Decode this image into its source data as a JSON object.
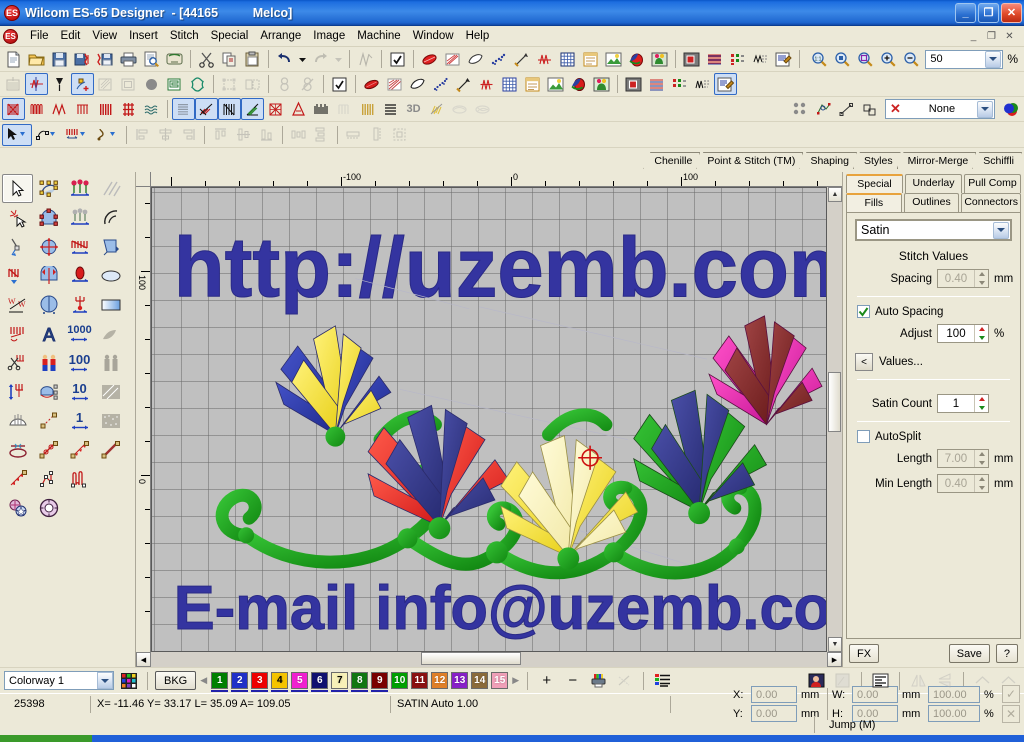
{
  "window": {
    "app_icon": "ES",
    "title": "Wilcom ES-65 Designer  - [44165          Melco]",
    "minimize": "_",
    "maximize": "❐",
    "close": "✕"
  },
  "menubar": {
    "logo": "ES",
    "items": [
      "File",
      "Edit",
      "View",
      "Insert",
      "Stitch",
      "Special",
      "Arrange",
      "Image",
      "Machine",
      "Window",
      "Help"
    ],
    "mdi_buttons": [
      "_",
      "❐",
      "✕"
    ]
  },
  "toolbars": {
    "standard": [
      {
        "name": "new-document",
        "icon": "page"
      },
      {
        "name": "open-document",
        "icon": "folder"
      },
      {
        "name": "save-document",
        "icon": "floppy"
      },
      {
        "name": "save-stitch-file",
        "icon": "floppy-stitch"
      },
      {
        "name": "save-as-machine-file",
        "icon": "floppy-machine"
      },
      {
        "name": "print",
        "icon": "printer"
      },
      {
        "name": "print-preview",
        "icon": "preview"
      },
      {
        "name": "send-to-machine",
        "icon": "machine"
      },
      {
        "name": "cut",
        "icon": "scissors"
      },
      {
        "name": "copy",
        "icon": "copy"
      },
      {
        "name": "paste",
        "icon": "clipboard"
      },
      {
        "name": "undo",
        "icon": "undo"
      },
      {
        "name": "undo-dropdown",
        "icon": "caret"
      },
      {
        "name": "redo",
        "icon": "redo"
      },
      {
        "name": "redo-dropdown",
        "icon": "caret"
      },
      {
        "name": "stitch-edit",
        "icon": "stitch-edit"
      },
      {
        "name": "properties",
        "icon": "props"
      },
      {
        "name": "object-properties",
        "icon": "checkbox"
      },
      {
        "name": "satin-fill",
        "icon": "satin"
      },
      {
        "name": "tatami-fill",
        "icon": "tatami"
      },
      {
        "name": "outline-fill",
        "icon": "outline"
      },
      {
        "name": "motif-fill",
        "icon": "motif"
      },
      {
        "name": "stitch-angle",
        "icon": "angle"
      },
      {
        "name": "stitch-direction",
        "icon": "direction"
      },
      {
        "name": "grid-toggle",
        "icon": "grid"
      },
      {
        "name": "hoop-toggle",
        "icon": "hoop"
      },
      {
        "name": "backdrop",
        "icon": "backdrop"
      },
      {
        "name": "color-fill",
        "icon": "colorfill"
      },
      {
        "name": "artwork",
        "icon": "artwork"
      },
      {
        "name": "bitmap-view",
        "icon": "bitmap"
      },
      {
        "name": "stitch-view",
        "icon": "stitchview"
      },
      {
        "name": "needle-points",
        "icon": "needlepoints"
      },
      {
        "name": "connectors-view",
        "icon": "connectors"
      },
      {
        "name": "design-info",
        "icon": "designinfo"
      }
    ],
    "arrange": [
      {
        "name": "align-left",
        "icon": "align-left",
        "disabled": true
      },
      {
        "name": "align-center-h",
        "icon": "align-center-h",
        "disabled": true
      },
      {
        "name": "align-right",
        "icon": "align-right",
        "disabled": true
      },
      {
        "name": "align-top",
        "icon": "align-top",
        "disabled": true
      },
      {
        "name": "align-middle",
        "icon": "align-middle",
        "disabled": true
      },
      {
        "name": "align-bottom",
        "icon": "align-bottom",
        "disabled": true
      },
      {
        "name": "distribute-h",
        "icon": "dist-h",
        "disabled": true
      },
      {
        "name": "distribute-v",
        "icon": "dist-v",
        "disabled": true
      },
      {
        "name": "same-width",
        "icon": "same-w",
        "disabled": true
      },
      {
        "name": "same-height",
        "icon": "same-h",
        "disabled": true
      },
      {
        "name": "same-size",
        "icon": "same-size",
        "disabled": true
      }
    ],
    "zoom": {
      "buttons": [
        {
          "name": "zoom-1-1",
          "icon": "zoom11"
        },
        {
          "name": "zoom-to-selection",
          "icon": "zoomsel"
        },
        {
          "name": "zoom-to-hoop",
          "icon": "zoomhoop"
        },
        {
          "name": "zoom-in",
          "icon": "zoomin"
        },
        {
          "name": "zoom-out",
          "icon": "zoomout"
        }
      ],
      "value": "50",
      "unit": "%"
    },
    "stitch_types": [
      {
        "name": "satin-stitch",
        "icon": "satin-red",
        "selected": true
      },
      {
        "name": "zigzag-stitch",
        "icon": "zigzag-red"
      },
      {
        "name": "e-stitch",
        "icon": "e-stitch"
      },
      {
        "name": "blanket-stitch",
        "icon": "blanket"
      },
      {
        "name": "tatami-stitch",
        "icon": "tatami-red"
      },
      {
        "name": "program-split",
        "icon": "prog-split"
      },
      {
        "name": "ripple-stitch",
        "icon": "ripple"
      },
      {
        "name": "fill-stitch",
        "icon": "fill-dots"
      },
      {
        "name": "contour-stitch",
        "icon": "contour"
      },
      {
        "name": "satin-column",
        "icon": "satin-col"
      },
      {
        "name": "gradient-fill",
        "icon": "gradient"
      },
      {
        "name": "cross-stitch",
        "icon": "cross"
      },
      {
        "name": "auto-applique",
        "icon": "applique"
      },
      {
        "name": "motif-run",
        "icon": "motif-run"
      },
      {
        "name": "candlewick",
        "icon": "candlewick",
        "disabled": true
      },
      {
        "name": "pattern-fill",
        "icon": "pattern-fill"
      },
      {
        "name": "stitch-layers",
        "icon": "layers"
      },
      {
        "name": "3d-view",
        "icon": "3d-text",
        "label": "3D"
      },
      {
        "name": "lettering-fill",
        "icon": "lettering-fill"
      },
      {
        "name": "trapunto",
        "icon": "trapunto",
        "disabled": true
      },
      {
        "name": "trapunto-outline",
        "icon": "trapunto2",
        "disabled": true
      }
    ],
    "modes": [
      {
        "name": "select-object-mode",
        "icon": "arrow-drop"
      },
      {
        "name": "reshape-mode",
        "icon": "reshape-drop"
      },
      {
        "name": "stitch-mode",
        "icon": "nn-drop"
      },
      {
        "name": "digitize-mode",
        "icon": "pen-drop"
      }
    ],
    "connectors": {
      "buttons": [
        {
          "name": "auto-start-stop",
          "icon": "autostartstop"
        },
        {
          "name": "connection-points",
          "icon": "connpoints"
        },
        {
          "name": "entry-point",
          "icon": "entry"
        },
        {
          "name": "exit-point",
          "icon": "exit"
        }
      ],
      "trim_icon": "red-x",
      "selected_value": "None",
      "color_wheel": "color-wheel"
    }
  },
  "doc_tabs": [
    "Chenille",
    "Point & Stitch (TM)",
    "Shaping",
    "Styles",
    "Mirror-Merge",
    "Schiffli"
  ],
  "left_toolbox": [
    {
      "name": "select-tool",
      "icon": "arrow",
      "selected": true
    },
    {
      "name": "reshape-tool",
      "icon": "reshape-node"
    },
    {
      "name": "lettering-tool",
      "icon": "flowers"
    },
    {
      "name": "slow-redraw-tool",
      "icon": "diag-lines"
    },
    {
      "name": "magic-wand-tool",
      "icon": "magic-wand"
    },
    {
      "name": "arch-reshape-tool",
      "icon": "arch-node"
    },
    {
      "name": "motif-lettering-tool",
      "icon": "flower-gray"
    },
    {
      "name": "arc-tool",
      "icon": "arc"
    },
    {
      "name": "knife-tool",
      "icon": "knife"
    },
    {
      "name": "mirror-merge-tool",
      "icon": "mirror-circle"
    },
    {
      "name": "zigzag-tool",
      "icon": "zigzag-red2"
    },
    {
      "name": "break-apart-tool",
      "icon": "break-apart"
    },
    {
      "name": "stitch-editor-tool",
      "icon": "stitch-arrow"
    },
    {
      "name": "mirror-horizontal-tool",
      "icon": "mirror-x"
    },
    {
      "name": "satin-blob-tool",
      "icon": "red-blob"
    },
    {
      "name": "ellipse-tool",
      "icon": "ellipse"
    },
    {
      "name": "stitch-swap-tool",
      "icon": "w-swap"
    },
    {
      "name": "wreath-tool",
      "icon": "wreath"
    },
    {
      "name": "anchor-stitch-tool",
      "icon": "anchor"
    },
    {
      "name": "rectangle-tool",
      "icon": "rect-grad"
    },
    {
      "name": "remove-stitches-tool",
      "icon": "stitch-cut"
    },
    {
      "name": "letter-a-tool",
      "icon": "letter-a"
    },
    {
      "name": "stitch-count-1000",
      "icon": "num",
      "label": "1000"
    },
    {
      "name": "fabric-tool",
      "icon": "fabric-gray"
    },
    {
      "name": "trim-tool",
      "icon": "scissors-stitch"
    },
    {
      "name": "twins-tool",
      "icon": "twins"
    },
    {
      "name": "stitch-count-100",
      "icon": "num",
      "label": "100"
    },
    {
      "name": "figures-tool",
      "icon": "figures-gray"
    },
    {
      "name": "insert-stitch-tool",
      "icon": "insert-stitch"
    },
    {
      "name": "envelope-tool",
      "icon": "envelope-node"
    },
    {
      "name": "stitch-count-10",
      "icon": "num",
      "label": "10"
    },
    {
      "name": "texture-tool",
      "icon": "texture-gray"
    },
    {
      "name": "fan-tool",
      "icon": "fan"
    },
    {
      "name": "open-line-tool",
      "icon": "open-line"
    },
    {
      "name": "stitch-count-1",
      "icon": "num",
      "label": "1"
    },
    {
      "name": "noise-tool",
      "icon": "noise-gray"
    },
    {
      "name": "elastic-tool",
      "icon": "elastic"
    },
    {
      "name": "curve-line-tool",
      "icon": "curve-line"
    },
    {
      "name": "motif-line-tool",
      "icon": "motif-line"
    },
    {
      "name": "straight-line-tool",
      "icon": "straight-line"
    },
    {
      "name": "run-line-tool",
      "icon": "run-line"
    },
    {
      "name": "polyline-tool",
      "icon": "polyline"
    },
    {
      "name": "zigzag-line-tool",
      "icon": "zigzag-line"
    },
    {
      "name": "star-stamp-tool",
      "icon": "star-stamp"
    },
    {
      "name": "wheel-tool",
      "icon": "wheel"
    }
  ],
  "rulers": {
    "horizontal_labels": [
      "-100",
      "0",
      "100"
    ],
    "vertical_labels": [
      "100",
      "0"
    ]
  },
  "canvas": {
    "design_text_top": "http://uzemb.com",
    "design_text_bottom": "E-mail  info@uzemb.com",
    "text_color": "#3434a0",
    "background": "#c0c0c0",
    "flower_colors": [
      "#f2e23c",
      "#2c3aa8",
      "#e63030",
      "#3a3f8c",
      "#f5f0a8",
      "#2b9b2b",
      "#3b3fa0",
      "#e03ab0",
      "#8b2b2b"
    ],
    "vine_color": "#2eb82e"
  },
  "right_panel": {
    "tabs_top": [
      "Special",
      "Underlay",
      "Pull Comp"
    ],
    "tabs_bottom": [
      "Fills",
      "Outlines",
      "Connectors"
    ],
    "active_tab": "Fills",
    "fill_type": "Satin",
    "stitch_values_header": "Stitch Values",
    "spacing_label": "Spacing",
    "spacing_value": "0.40",
    "spacing_unit": "mm",
    "auto_spacing_label": "Auto Spacing",
    "auto_spacing_checked": true,
    "adjust_label": "Adjust",
    "adjust_value": "100",
    "adjust_unit": "%",
    "values_button": "Values...",
    "values_arrow": "<",
    "satin_count_label": "Satin Count",
    "satin_count_value": "1",
    "autosplit_label": "AutoSplit",
    "autosplit_checked": false,
    "length_label": "Length",
    "length_value": "7.00",
    "length_unit": "mm",
    "min_length_label": "Min Length",
    "min_length_value": "0.40",
    "min_length_unit": "mm",
    "fx_button": "FX",
    "save_button": "Save",
    "help_button": "?"
  },
  "colorbar": {
    "colorway_value": "Colorway 1",
    "palette_icon": "palette-icon",
    "bkg_button": "BKG",
    "prev_arrow": "◀",
    "next_arrow": "▶",
    "swatches": [
      {
        "num": "1",
        "color": "#008000",
        "text": "#ffffff",
        "used": true
      },
      {
        "num": "2",
        "color": "#2030c8",
        "text": "#ffffff",
        "used": true
      },
      {
        "num": "3",
        "color": "#ee0000",
        "text": "#ffffff",
        "used": true
      },
      {
        "num": "4",
        "color": "#f5c400",
        "text": "#000000",
        "used": true
      },
      {
        "num": "5",
        "color": "#f020d0",
        "text": "#ffffff",
        "used": true
      },
      {
        "num": "6",
        "color": "#101070",
        "text": "#ffffff",
        "used": true
      },
      {
        "num": "7",
        "color": "#f7f0b8",
        "text": "#000000",
        "used": true
      },
      {
        "num": "8",
        "color": "#117711",
        "text": "#ffffff",
        "used": true
      },
      {
        "num": "9",
        "color": "#7a0000",
        "text": "#ffffff",
        "used": true
      },
      {
        "num": "10",
        "color": "#00a000",
        "text": "#ffffff",
        "used": false
      },
      {
        "num": "11",
        "color": "#8b1111",
        "text": "#ffffff",
        "used": false
      },
      {
        "num": "12",
        "color": "#e08028",
        "text": "#ffffff",
        "used": false
      },
      {
        "num": "13",
        "color": "#8820c8",
        "text": "#ffffff",
        "used": false
      },
      {
        "num": "14",
        "color": "#8b6b3a",
        "text": "#ffffff",
        "used": false
      },
      {
        "num": "15",
        "color": "#f0a0b8",
        "text": "#ffffff",
        "used": false
      }
    ],
    "tools": [
      {
        "name": "add-color-button",
        "label": "+"
      },
      {
        "name": "remove-color-button",
        "label": "−"
      },
      {
        "name": "color-printer-button",
        "icon": "color-printer"
      },
      {
        "name": "hide-color-button",
        "icon": "hide-color",
        "disabled": true
      },
      {
        "name": "color-list-button",
        "icon": "color-list"
      }
    ],
    "right_tools": [
      {
        "name": "object-fill-button",
        "icon": "face-fill"
      },
      {
        "name": "object-outline-button",
        "icon": "outline-sq",
        "disabled": true
      },
      {
        "name": "text-align-button",
        "icon": "text-align"
      },
      {
        "name": "mirror-horizontal-button",
        "icon": "mirror-h",
        "disabled": true
      },
      {
        "name": "mirror-vertical-button",
        "icon": "mirror-v",
        "disabled": true
      },
      {
        "name": "rotate-cw-button",
        "icon": "rot-cw",
        "disabled": true
      },
      {
        "name": "rotate-ccw-button",
        "icon": "rot-ccw",
        "disabled": true
      }
    ]
  },
  "statusbar": {
    "stitch_count": "25398",
    "coords": "X= -11.46 Y=  33.17 L=  35.09 A= 109.05",
    "stitch_info": "SATIN Auto  1.00",
    "jump_label": "Jump (M)",
    "x_label": "X:",
    "x_value": "0.00",
    "y_label": "Y:",
    "y_value": "0.00",
    "w_label": "W:",
    "w_value": "0.00",
    "h_label": "H:",
    "h_value": "0.00",
    "w_pct": "100.00",
    "h_pct": "100.00",
    "mm": "mm",
    "pct": "%",
    "apply_icon": "check-icon",
    "cancel_icon": "x-icon"
  }
}
